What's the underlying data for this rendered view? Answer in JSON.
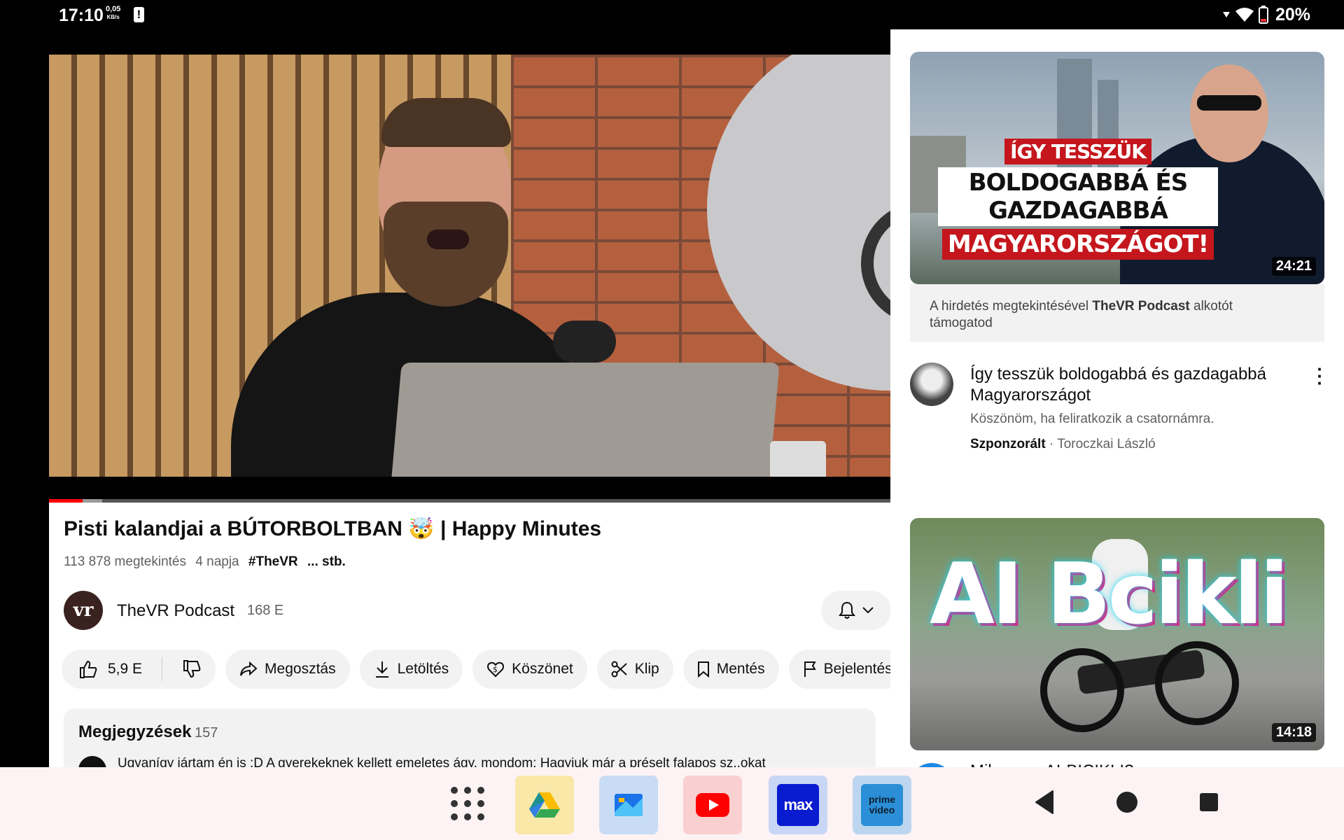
{
  "status_bar": {
    "time": "17:10",
    "net_speed_value": "0,05",
    "net_speed_unit": "KB/s",
    "alert_glyph": "!",
    "battery_percent": "20%",
    "icons": [
      "notification-alert-icon",
      "data-arrows-icon",
      "wifi-icon",
      "battery-icon"
    ]
  },
  "player": {
    "progress_fraction": 0.04,
    "buffer_fraction": 0.063
  },
  "video": {
    "title": "Pisti kalandjai a BÚTORBOLTBAN 🤯 | Happy Minutes",
    "views": "113 878 megtekintés",
    "age": "4 napja",
    "hashtag": "#TheVR",
    "more": "... stb."
  },
  "channel": {
    "avatar_text": "vr",
    "name": "TheVR Podcast",
    "subscribers": "168 E"
  },
  "actions": {
    "like_count": "5,9 E",
    "share": "Megosztás",
    "download": "Letöltés",
    "thanks": "Köszönet",
    "clip": "Klip",
    "save": "Mentés",
    "report": "Bejelentés"
  },
  "comments": {
    "title": "Megjegyzések",
    "count": "157",
    "preview": "Ugyanígy jártam én is :D A gyerekeknek kellett emeletes ágy, mondom: Hagyjuk már a préselt falapos sz..okat"
  },
  "ad": {
    "thumb_line1": "ÍGY TESSZÜK",
    "thumb_line2": "BOLDOGABBÁ ÉS GAZDAGABBÁ",
    "thumb_line3": "MAGYARORSZÁGOT!",
    "duration": "24:21",
    "support_prefix": "A hirdetés megtekintésével",
    "support_channel": "TheVR Podcast",
    "support_suffix": "alkotót támogatod",
    "title": "Így tesszük boldogabbá és gazdagabbá Magyarországot",
    "description": "Köszönöm, ha feliratkozik a csatornámra.",
    "sponsored": "Szponzorált",
    "advertiser": "Toroczkai László"
  },
  "next_video": {
    "thumb_text": "AI Bcikli",
    "duration": "14:18",
    "title_partial": "Milyen az AI-BICIKLI?"
  },
  "dock": {
    "apps": [
      {
        "name": "Google Drive",
        "icon": "drive-icon"
      },
      {
        "name": "Files",
        "icon": "files-icon"
      },
      {
        "name": "YouTube",
        "icon": "youtube-icon"
      },
      {
        "name": "Max",
        "icon": "max-icon",
        "label": "max"
      },
      {
        "name": "Prime Video",
        "icon": "prime-video-icon",
        "label1": "prime",
        "label2": "video"
      }
    ]
  },
  "colors": {
    "accent_red": "#ff0000",
    "pill_bg": "#f2f2f2",
    "nav_bg": "#fdf3f4"
  }
}
